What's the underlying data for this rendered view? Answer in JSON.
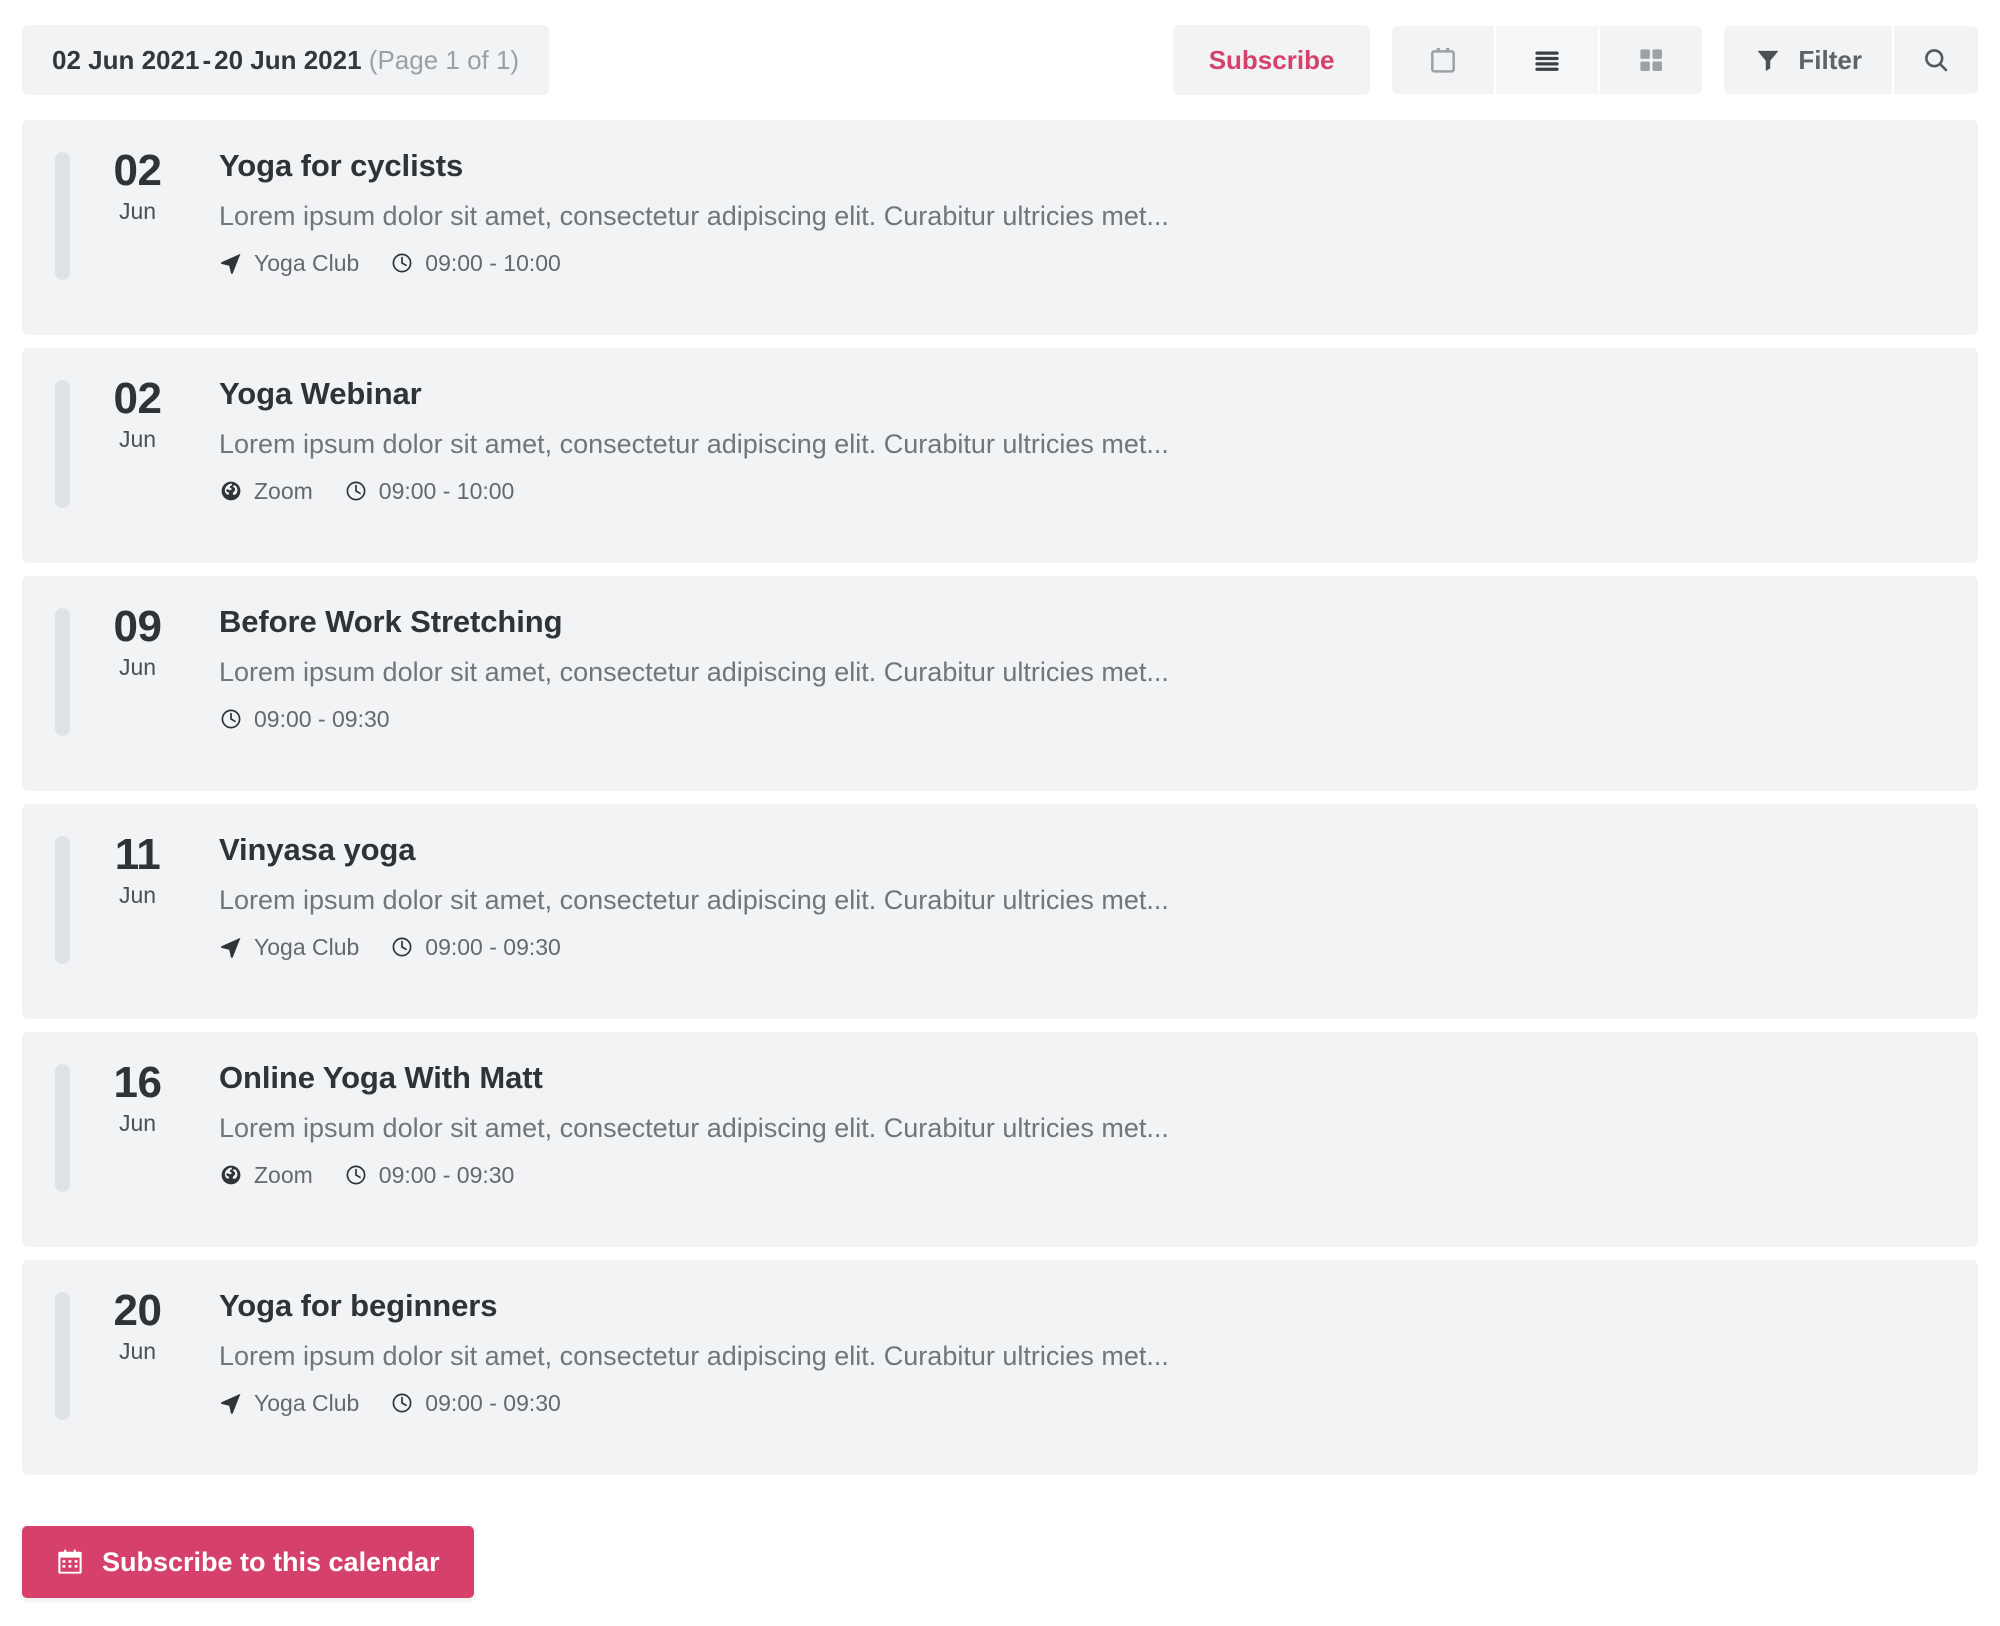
{
  "toolbar": {
    "date_start": "02 Jun 2021",
    "date_separator": "-",
    "date_end": "20 Jun 2021",
    "page_info": "(Page 1 of 1)",
    "subscribe_label": "Subscribe",
    "filter_label": "Filter",
    "views": [
      {
        "name": "calendar-view",
        "icon": "calendar-icon",
        "active": false
      },
      {
        "name": "list-view",
        "icon": "list-bars-icon",
        "active": true
      },
      {
        "name": "grid-view",
        "icon": "grid-icon",
        "active": false
      }
    ],
    "search_icon": "search-icon",
    "filter_icon": "funnel-icon",
    "accent_color": "#d6416b"
  },
  "events": [
    {
      "day": "02",
      "month": "Jun",
      "title": "Yoga for cyclists",
      "description": "Lorem ipsum dolor sit amet, consectetur adipiscing elit. Curabitur ultricies met...",
      "location": "Yoga Club",
      "location_icon": "navigation-arrow-icon",
      "time": "09:00 - 10:00",
      "time_icon": "clock-icon"
    },
    {
      "day": "02",
      "month": "Jun",
      "title": "Yoga Webinar",
      "description": "Lorem ipsum dolor sit amet, consectetur adipiscing elit. Curabitur ultricies met...",
      "location": "Zoom",
      "location_icon": "globe-icon",
      "time": "09:00 - 10:00",
      "time_icon": "clock-icon"
    },
    {
      "day": "09",
      "month": "Jun",
      "title": "Before Work Stretching",
      "description": "Lorem ipsum dolor sit amet, consectetur adipiscing elit. Curabitur ultricies met...",
      "location": "",
      "location_icon": "",
      "time": "09:00 - 09:30",
      "time_icon": "clock-icon"
    },
    {
      "day": "11",
      "month": "Jun",
      "title": "Vinyasa yoga",
      "description": "Lorem ipsum dolor sit amet, consectetur adipiscing elit. Curabitur ultricies met...",
      "location": "Yoga Club",
      "location_icon": "navigation-arrow-icon",
      "time": "09:00 - 09:30",
      "time_icon": "clock-icon"
    },
    {
      "day": "16",
      "month": "Jun",
      "title": "Online Yoga With Matt",
      "description": "Lorem ipsum dolor sit amet, consectetur adipiscing elit. Curabitur ultricies met...",
      "location": "Zoom",
      "location_icon": "globe-icon",
      "time": "09:00 - 09:30",
      "time_icon": "clock-icon"
    },
    {
      "day": "20",
      "month": "Jun",
      "title": "Yoga for beginners",
      "description": "Lorem ipsum dolor sit amet, consectetur adipiscing elit. Curabitur ultricies met...",
      "location": "Yoga Club",
      "location_icon": "navigation-arrow-icon",
      "time": "09:00 - 09:30",
      "time_icon": "clock-icon"
    }
  ],
  "footer": {
    "subscribe_calendar_label": "Subscribe to this calendar",
    "subscribe_calendar_icon": "calendar-grid-icon"
  }
}
